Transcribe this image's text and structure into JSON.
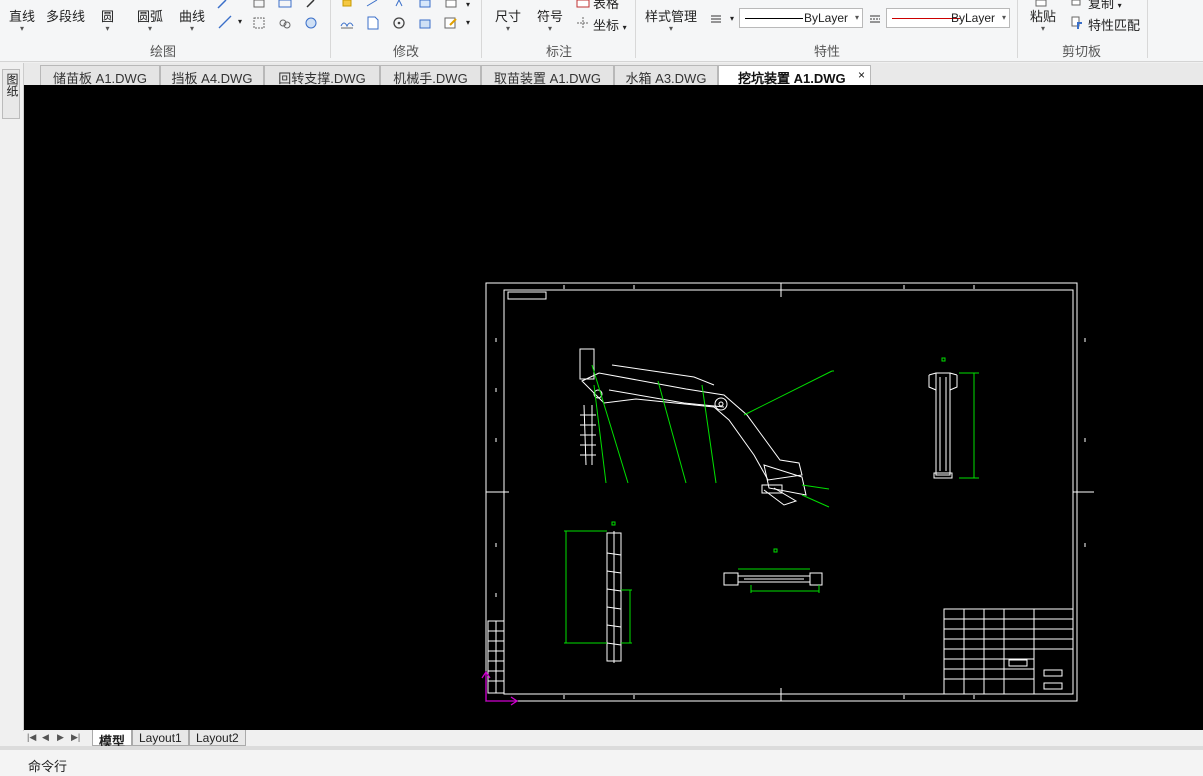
{
  "ribbon": {
    "draw_group": {
      "label": "绘图",
      "line": "直线",
      "polyline": "多段线",
      "circle": "圆",
      "arc": "圆弧",
      "curve": "曲线"
    },
    "modify_group": {
      "label": "修改"
    },
    "annotate_group": {
      "label": "标注",
      "dimension": "尺寸",
      "symbol": "符号",
      "table": "表格",
      "coordinate": "坐标"
    },
    "properties_group": {
      "label": "特性",
      "style_manager": "样式管理",
      "linetype_value": "ByLayer",
      "color_value": "ByLayer"
    },
    "clipboard_group": {
      "label": "剪切板",
      "paste": "粘贴",
      "copy": "复制",
      "match_properties": "特性匹配"
    }
  },
  "tabs": [
    {
      "label": "储苗板 A1.DWG",
      "active": false
    },
    {
      "label": "挡板 A4.DWG",
      "active": false
    },
    {
      "label": "回转支撑.DWG",
      "active": false
    },
    {
      "label": "机械手.DWG",
      "active": false
    },
    {
      "label": "取苗装置 A1.DWG",
      "active": false
    },
    {
      "label": "水箱 A3.DWG",
      "active": false
    },
    {
      "label": "挖坑装置 A1.DWG",
      "active": true
    }
  ],
  "tab_close": "×",
  "side_panel_label": "图纸",
  "layouts": [
    {
      "label": "模型",
      "active": true
    },
    {
      "label": "Layout1",
      "active": false
    },
    {
      "label": "Layout2",
      "active": false
    }
  ],
  "command_line": {
    "label": "命令行"
  },
  "colors": {
    "canvas_bg": "#000000",
    "drawing_lines": "#ffffff",
    "leader_lines": "#00e000",
    "ucs_icon": "#d000d0",
    "linetype_red": "#cc0000"
  }
}
